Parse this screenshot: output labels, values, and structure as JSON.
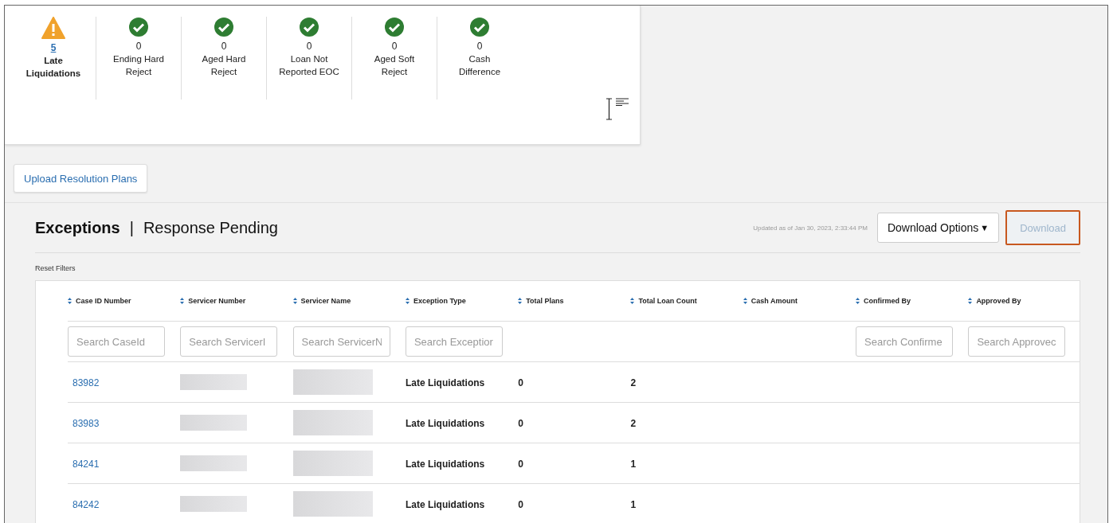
{
  "summary": [
    {
      "kind": "warning",
      "count": "5",
      "label": "Late Liquidations"
    },
    {
      "kind": "ok",
      "count": "0",
      "label": "Ending Hard Reject"
    },
    {
      "kind": "ok",
      "count": "0",
      "label": "Aged Hard Reject"
    },
    {
      "kind": "ok",
      "count": "0",
      "label": "Loan Not Reported EOC"
    },
    {
      "kind": "ok",
      "count": "0",
      "label": "Aged Soft Reject"
    },
    {
      "kind": "ok",
      "count": "0",
      "label": "Cash Difference"
    }
  ],
  "upload_button": "Upload Resolution Plans",
  "section": {
    "title": "Exceptions",
    "separator": "|",
    "subtitle": "Response Pending",
    "updated": "Updated as of Jan 30, 2023, 2:33:44 PM"
  },
  "download_options": {
    "label": "Download Options",
    "caret": "▼"
  },
  "download": {
    "label": "Download",
    "disabled": true,
    "highlighted": true
  },
  "reset_filters": "Reset Filters",
  "table": {
    "columns": [
      {
        "label": "Case ID Number",
        "placeholder": "Search CaseId"
      },
      {
        "label": "Servicer Number",
        "placeholder": "Search ServicerI"
      },
      {
        "label": "Servicer Name",
        "placeholder": "Search ServicerN"
      },
      {
        "label": "Exception Type",
        "placeholder": "Search Exceptior"
      },
      {
        "label": "Total Plans"
      },
      {
        "label": "Total Loan Count"
      },
      {
        "label": "Cash Amount"
      },
      {
        "label": "Confirmed By",
        "placeholder": "Search Confirme"
      },
      {
        "label": "Approved By",
        "placeholder": "Search Approvec"
      }
    ],
    "rows": [
      {
        "case_id": "83982",
        "redacted": true,
        "exception_type": "Late Liquidations",
        "total_plans": "0",
        "total_loan_count": "2"
      },
      {
        "case_id": "83983",
        "redacted": true,
        "exception_type": "Late Liquidations",
        "total_plans": "0",
        "total_loan_count": "2"
      },
      {
        "case_id": "84241",
        "redacted": true,
        "exception_type": "Late Liquidations",
        "total_plans": "0",
        "total_loan_count": "1"
      },
      {
        "case_id": "84242",
        "redacted": true,
        "exception_type": "Late Liquidations",
        "total_plans": "0",
        "total_loan_count": "1"
      }
    ]
  }
}
